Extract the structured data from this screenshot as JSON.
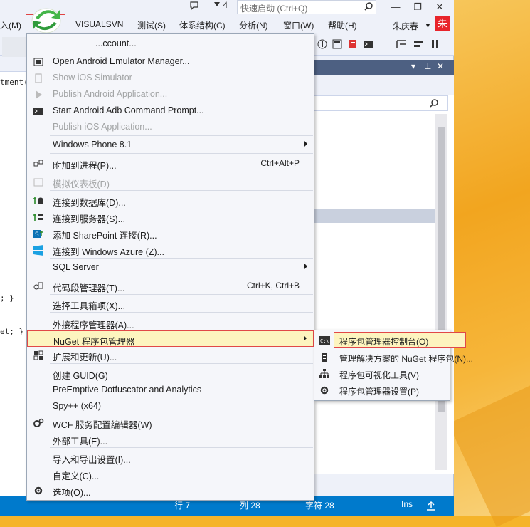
{
  "colors": {
    "accent": "#007acc",
    "menu_highlight": "#fdf4bf",
    "red_outline": "#e14848"
  },
  "titlebar": {
    "notification_count": "4",
    "quick_launch_placeholder": "快速启动 (Ctrl+Q)",
    "minimize": "—",
    "restore": "❐",
    "close": "✕"
  },
  "menubar": {
    "items": [
      "入(M)",
      "VISUALSVN",
      "测试(S)",
      "体系结构(C)",
      "分析(N)",
      "窗口(W)",
      "帮助(H)"
    ],
    "user_name": "朱庆春",
    "avatar_char": "朱"
  },
  "editor": {
    "lines": [
      "tment()",
      "; }",
      "et; }"
    ]
  },
  "menu": {
    "items": [
      {
        "label": "...ccount...",
        "icon": "account-icon"
      },
      {
        "label": "Open Android Emulator Manager...",
        "icon": "android-emulator-icon"
      },
      {
        "label": "Show iOS Simulator",
        "disabled": true,
        "icon": "ios-simulator-icon"
      },
      {
        "label": "Publish Android Application...",
        "disabled": true,
        "icon": "play-icon"
      },
      {
        "label": "Start Android Adb Command Prompt...",
        "icon": "console-icon"
      },
      {
        "label": "Publish iOS Application...",
        "disabled": true
      },
      {
        "label": "Windows Phone 8.1",
        "submenu": true
      },
      {
        "label": "附加到进程(P)...",
        "shortcut": "Ctrl+Alt+P",
        "icon": "attach-process-icon"
      },
      {
        "label": "模拟仪表板(D)",
        "disabled": true,
        "icon": "dashboard-icon"
      },
      {
        "label": "连接到数据库(D)...",
        "icon": "database-connect-icon"
      },
      {
        "label": "连接到服务器(S)...",
        "icon": "server-connect-icon"
      },
      {
        "label": "添加 SharePoint 连接(R)...",
        "icon": "sharepoint-icon"
      },
      {
        "label": "连接到 Windows Azure (Z)...",
        "icon": "windows-icon"
      },
      {
        "label": "SQL Server",
        "submenu": true
      },
      {
        "label": "代码段管理器(T)...",
        "shortcut": "Ctrl+K, Ctrl+B",
        "icon": "snippet-icon"
      },
      {
        "label": "选择工具箱项(X)..."
      },
      {
        "label": "外接程序管理器(A)..."
      },
      {
        "label": "NuGet 程序包管理器",
        "submenu": true
      },
      {
        "label": "扩展和更新(U)...",
        "icon": "extensions-icon"
      },
      {
        "label": "创建 GUID(G)"
      },
      {
        "label": "PreEmptive Dotfuscator and Analytics"
      },
      {
        "label": "Spy++ (x64)"
      },
      {
        "label": "WCF 服务配置编辑器(W)",
        "icon": "wcf-gear-icon"
      },
      {
        "label": "外部工具(E)..."
      },
      {
        "label": "导入和导出设置(I)..."
      },
      {
        "label": "自定义(C)..."
      },
      {
        "label": "选项(O)...",
        "icon": "gear-icon"
      }
    ]
  },
  "submenu": {
    "items": [
      {
        "label": "程序包管理器控制台(O)",
        "icon": "console-icon"
      },
      {
        "label": "管理解决方案的 NuGet 程序包(N)...",
        "icon": "package-icon"
      },
      {
        "label": "程序包可视化工具(V)",
        "icon": "hierarchy-icon"
      },
      {
        "label": "程序包管理器设置(P)",
        "icon": "gear-icon"
      }
    ]
  },
  "statusbar": {
    "line": "行 7",
    "col": "列 28",
    "char": "字符 28",
    "mode": "Ins"
  }
}
